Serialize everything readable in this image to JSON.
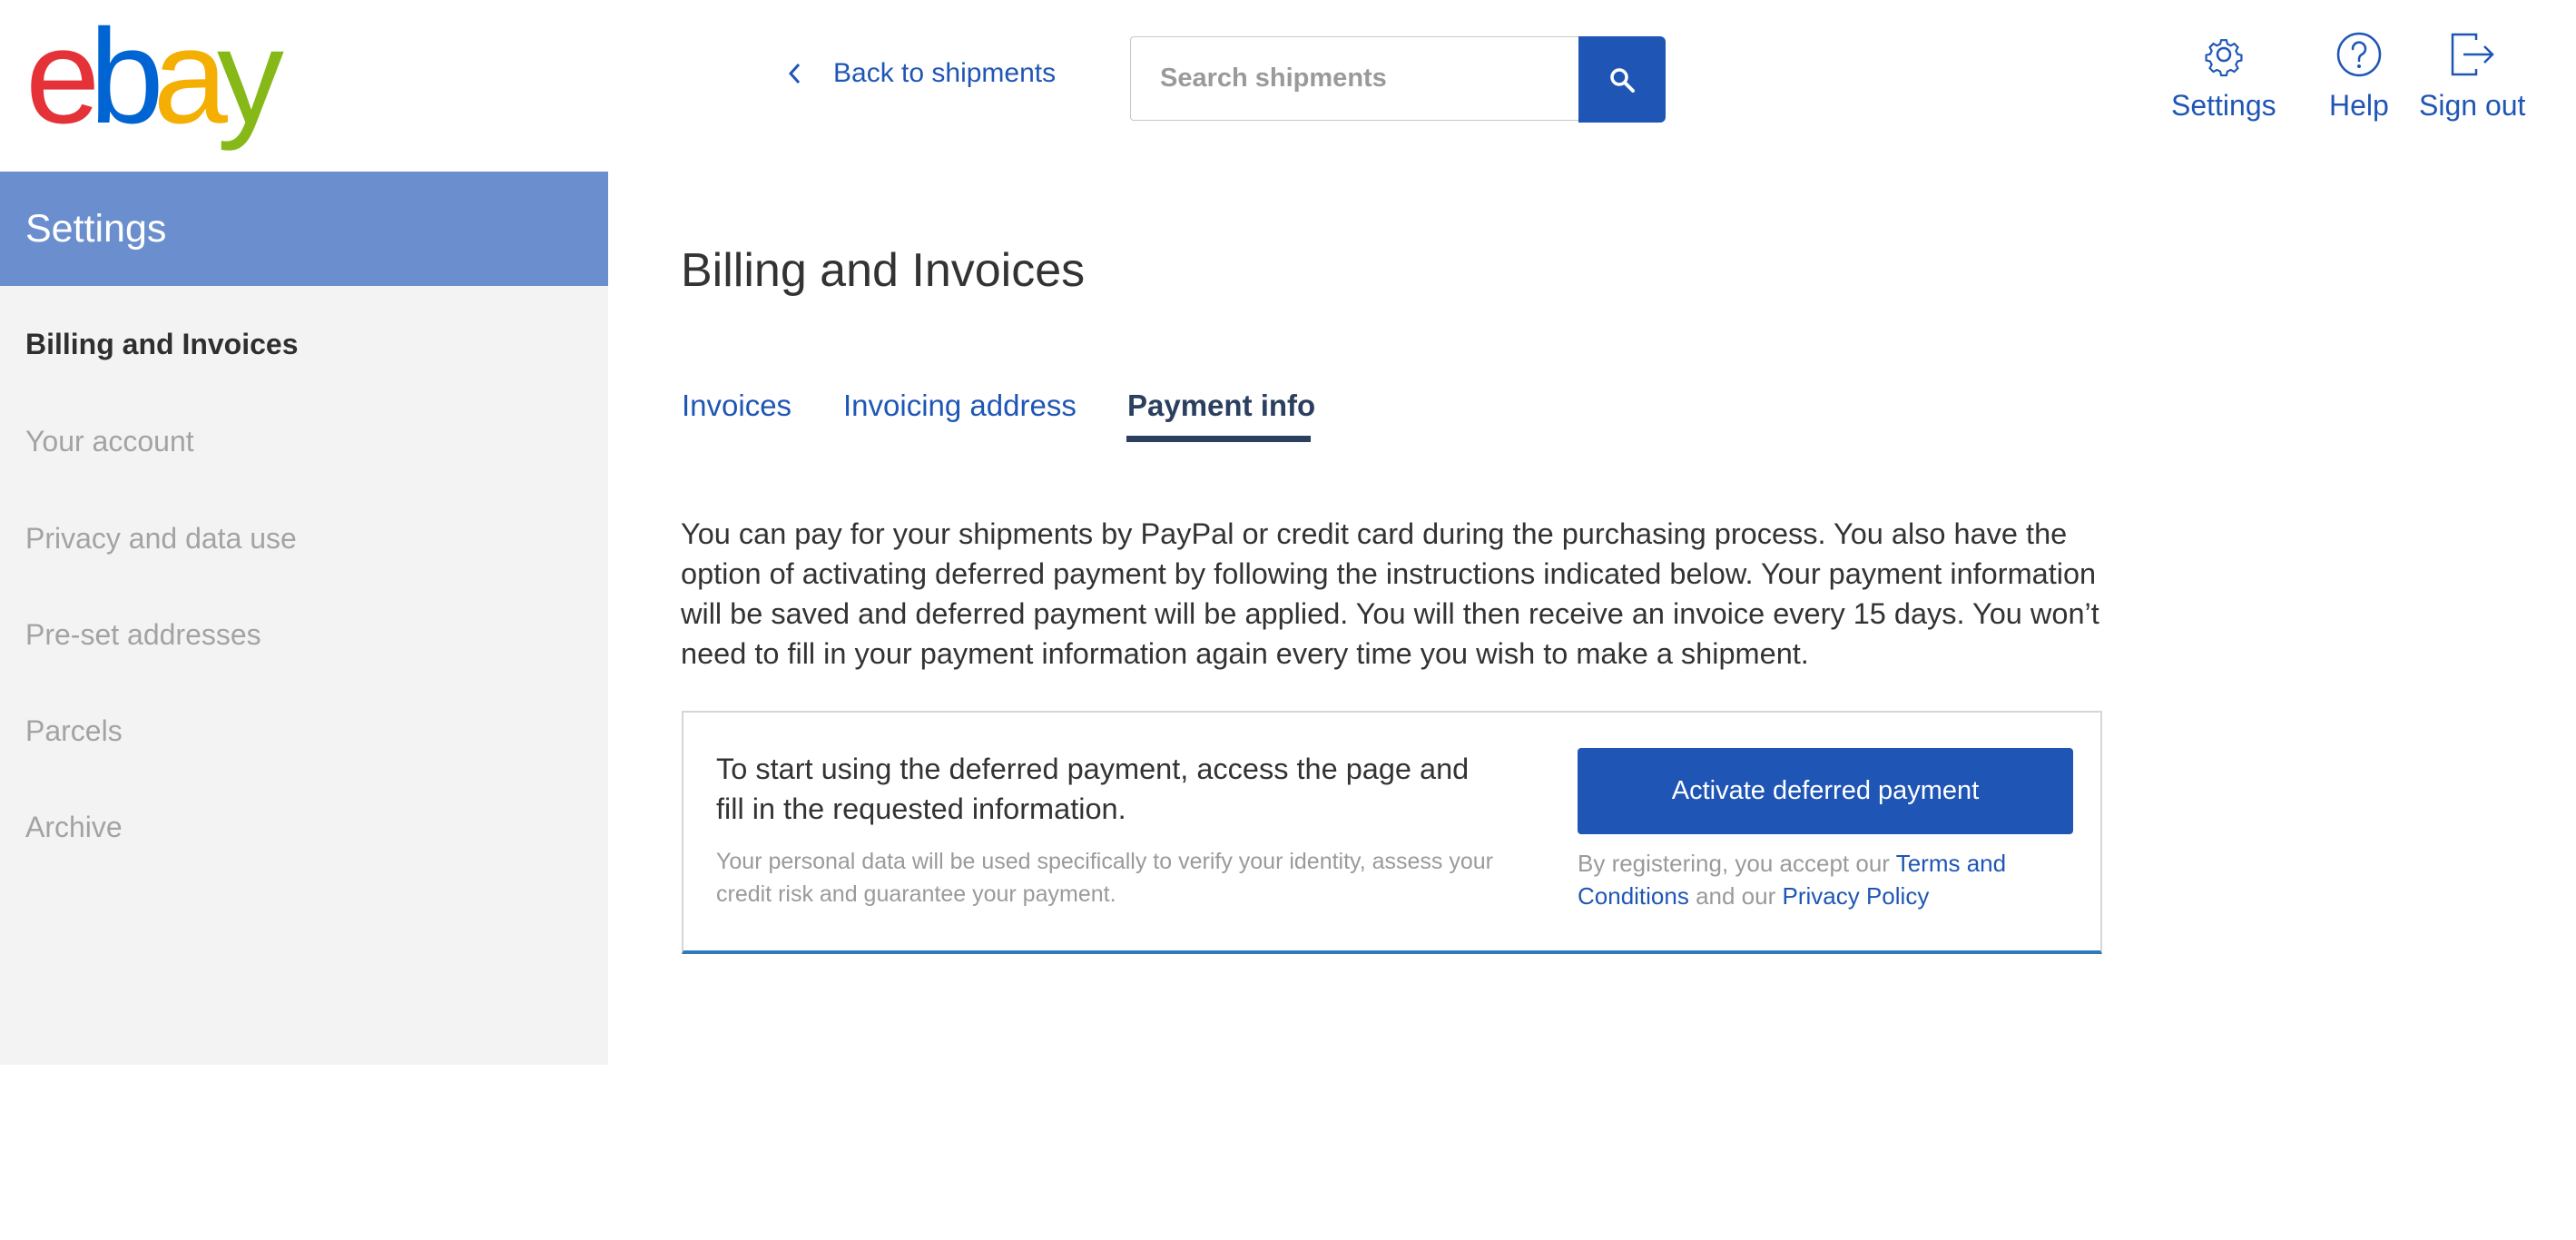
{
  "brand": {
    "letters": [
      "e",
      "b",
      "a",
      "y"
    ],
    "colors": [
      "#e53238",
      "#0064d2",
      "#f5af02",
      "#86b817"
    ]
  },
  "header": {
    "back_label": "Back to shipments",
    "search_placeholder": "Search shipments",
    "nav": [
      {
        "label": "Settings",
        "icon": "gear-icon"
      },
      {
        "label": "Help",
        "icon": "help-icon"
      },
      {
        "label": "Sign out",
        "icon": "sign-out-icon"
      }
    ]
  },
  "sidebar": {
    "title": "Settings",
    "items": [
      {
        "label": "Billing and Invoices",
        "active": true
      },
      {
        "label": "Your account"
      },
      {
        "label": "Privacy and data use"
      },
      {
        "label": "Pre-set addresses"
      },
      {
        "label": "Parcels"
      },
      {
        "label": "Archive"
      }
    ]
  },
  "main": {
    "title": "Billing and Invoices",
    "tabs": [
      {
        "label": "Invoices"
      },
      {
        "label": "Invoicing address"
      },
      {
        "label": "Payment info",
        "active": true
      }
    ],
    "description": "You can pay for your shipments by PayPal or credit card during the purchasing process. You also have the option of activating deferred payment by following the instructions indicated below. Your payment information will be saved and deferred payment will be applied. You will then receive an invoice every 15 days. You won’t need to fill in your payment information again every time you wish to make a shipment.",
    "card": {
      "lead": "To start using the deferred payment, access the page and fill in the requested information.",
      "note": "Your personal data will be used specifically to verify your identity, assess your credit risk and guarantee your payment.",
      "button_label": "Activate deferred payment",
      "terms_prefix": "By registering, you accept our ",
      "terms_link": "Terms and Conditions",
      "terms_middle": " and our ",
      "privacy_link": "Privacy Policy"
    }
  },
  "colors": {
    "accent": "#1f56b5",
    "sidebar_header": "#6b8fce",
    "card_border_bottom": "#2d7bbd"
  }
}
